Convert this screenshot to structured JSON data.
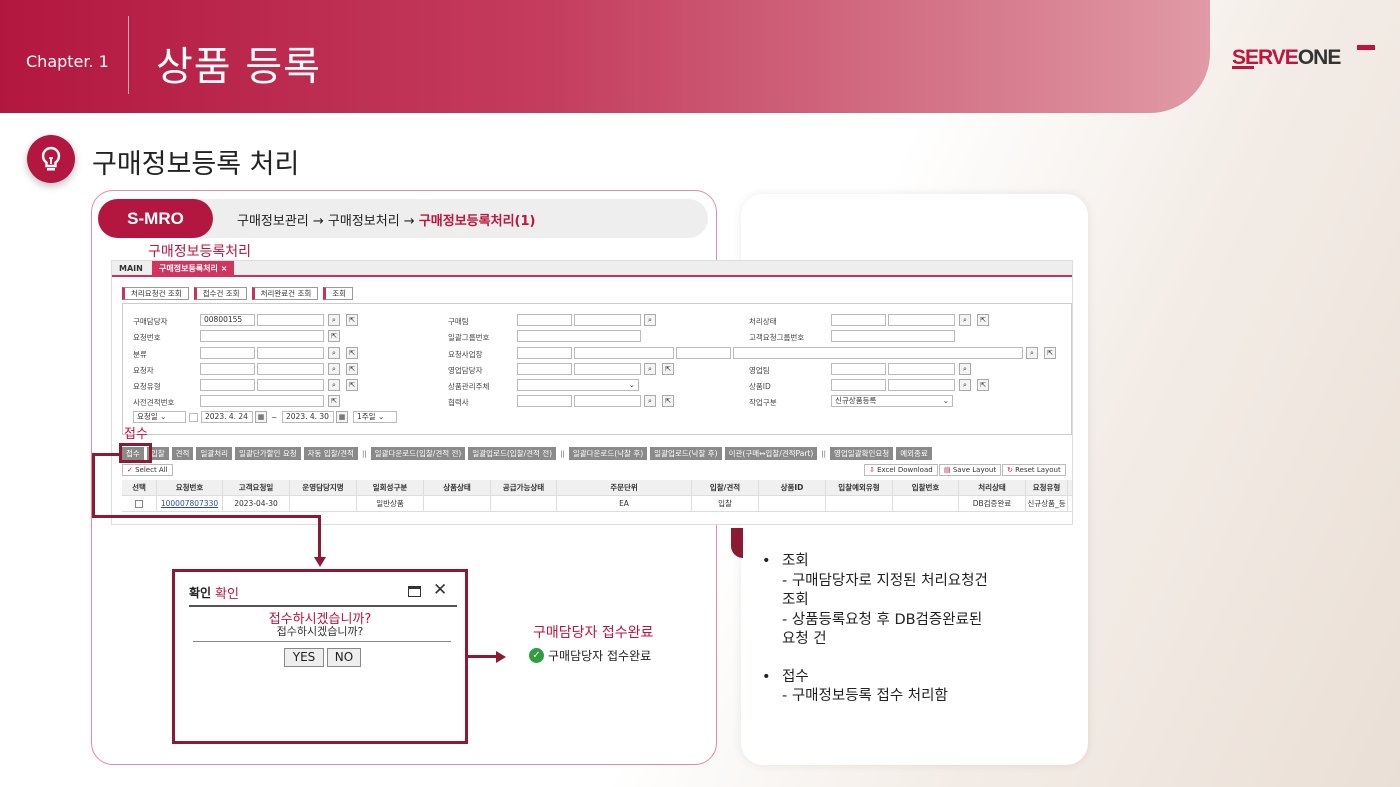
{
  "header": {
    "chapter": "Chapter. 1",
    "title": "상품 등록",
    "logo_a": "SERVE",
    "logo_b": "ONE"
  },
  "section": {
    "title": "구매정보등록 처리"
  },
  "left": {
    "badge": "S-MRO",
    "crumb": "구매정보관리 → 구매정보처리 → ",
    "crumb_hl": "구매정보등록처리(1)",
    "caption": "구매정보등록처리",
    "highlight_label": "접수"
  },
  "screen": {
    "tabs": [
      "MAIN",
      "구매정보등록처리"
    ],
    "search_buttons": [
      "처리요청건 조회",
      "접수건 조회",
      "처리완료건 조회",
      "조회"
    ],
    "form": {
      "c1": [
        "구매담당자",
        "요청번호",
        "분류",
        "요청자",
        "요청유형",
        "사전견적번호"
      ],
      "c2": [
        "구매팀",
        "일괄그룹번호",
        "요청사업장",
        "영업담당자",
        "상품관리주체",
        "협력사"
      ],
      "c3": [
        "처리상태",
        "고객요청그룹번호",
        "",
        "영업팀",
        "상품ID",
        "작업구분"
      ],
      "buyer_value": "00800155",
      "work_value": "신규상품등록",
      "date_type": "요청일",
      "date_from": "2023. 4. 24",
      "date_sep": "~",
      "date_to": "2023. 4. 30",
      "period": "1주일"
    },
    "actions": [
      "접수",
      "입찰",
      "견적",
      "일괄처리",
      "일괄단가할인 요청",
      "자동 입찰/견적",
      "||",
      "일괄다운로드(입찰/견적 전)",
      "일괄업로드(입찰/견적 전)",
      "||",
      "일괄다운로드(낙찰 후)",
      "일괄업로드(낙찰 후)",
      "이관(구매↔입찰/견적Part)",
      "||",
      "영업일괄확인요청",
      "예외종료"
    ],
    "tools": {
      "select_all": "Select All",
      "excel": "Excel Download",
      "save": "Save Layout",
      "reset": "Reset Layout"
    },
    "grid_headers": [
      "선택",
      "요청번호",
      "고객요청일",
      "운영담당지명",
      "일회성구분",
      "상품상태",
      "공급가능상태",
      "주문단위",
      "입찰/견적",
      "상품ID",
      "입찰예외유형",
      "입찰번호",
      "처리상태",
      "요청유형"
    ],
    "grid_row": [
      "",
      "100007807330",
      "2023-04-30",
      "",
      "일반상품",
      "",
      "",
      "EA",
      "입찰",
      "",
      "",
      "",
      "DB검증완료",
      "신규상품_등"
    ]
  },
  "dialog": {
    "title": "확인",
    "title_red": "확인",
    "msg_red": "접수하시겠습니까?",
    "msg": "접수하시겠습니까?",
    "yes": "YES",
    "no": "NO"
  },
  "done": {
    "caption": "구매담당자 접수완료",
    "message": "구매담당자 접수완료"
  },
  "right": {
    "b1": "조회",
    "b1_l1": "- 구매담당자로 지정된 처리요청건",
    "b1_l2": "조회",
    "b1_l3": "- 상품등록요청 후 DB검증완료된",
    "b1_l4": "요청 건",
    "b2": "접수",
    "b2_l1": "- 구매정보등록 접수 처리함"
  },
  "colors": {
    "brand": "#b3173f",
    "accent_dark": "#8b1a32",
    "ok": "#2e9e3e"
  }
}
